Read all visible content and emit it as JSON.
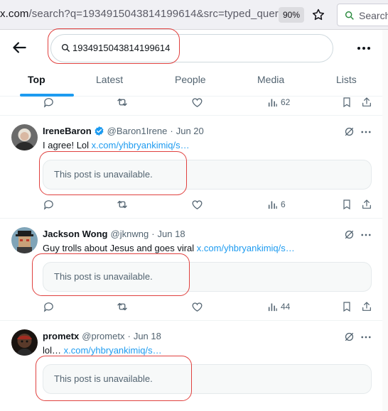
{
  "browser": {
    "url_host": "x.com",
    "url_rest": "/search?q=1934915043814199614&src=typed_query",
    "zoom": "90%",
    "toolbar_search_placeholder": "Search"
  },
  "search": {
    "query": "1934915043814199614"
  },
  "tabs": [
    {
      "label": "Top",
      "active": true
    },
    {
      "label": "Latest"
    },
    {
      "label": "People"
    },
    {
      "label": "Media"
    },
    {
      "label": "Lists"
    }
  ],
  "top_actions": {
    "views": "62"
  },
  "tweets": [
    {
      "name": "IreneBaron",
      "verified": true,
      "handle": "@Baron1Irene",
      "date": "Jun 20",
      "text": "I agree! Lol ",
      "link": "x.com/yhbryankimiq/s…",
      "quote": "This post is unavailable.",
      "views": "6"
    },
    {
      "name": "Jackson Wong",
      "verified": false,
      "handle": "@jknwng",
      "date": "Jun 18",
      "text": "Guy trolls about Jesus and goes viral ",
      "link": "x.com/yhbryankimiq/s…",
      "quote": "This post is unavailable.",
      "views": "44"
    },
    {
      "name": "prometx",
      "verified": false,
      "handle": "@prometx",
      "date": "Jun 18",
      "text": "lol… ",
      "link": "x.com/yhbryankimiq/s…",
      "quote": "This post is unavailable."
    }
  ],
  "colors": {
    "accent": "#1d9bf0",
    "annotation": "#e0413f",
    "text_secondary": "#536471"
  }
}
